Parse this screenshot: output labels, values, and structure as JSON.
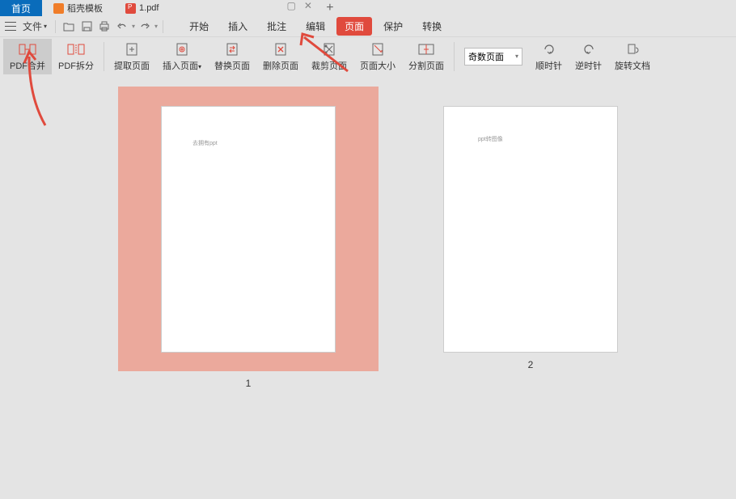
{
  "tabs": {
    "home": "首页",
    "doc1": "稻壳模板",
    "doc2": "1.pdf"
  },
  "file_menu": {
    "label": "文件"
  },
  "menus": [
    "开始",
    "插入",
    "批注",
    "编辑",
    "页面",
    "保护",
    "转换"
  ],
  "active_menu_index": 4,
  "tools": {
    "t0": "PDF合并",
    "t1": "PDF拆分",
    "t2": "提取页面",
    "t3": "插入页面",
    "t4": "替换页面",
    "t5": "删除页面",
    "t6": "裁剪页面",
    "t7": "页面大小",
    "t8": "分割页面",
    "r0": "顺时针",
    "r1": "逆时针",
    "r2": "旋转文档"
  },
  "page_select": {
    "value": "奇数页面"
  },
  "pages": {
    "p1": {
      "num": "1",
      "text": "去拥有ppt"
    },
    "p2": {
      "num": "2",
      "text": "ppt转图像"
    }
  }
}
